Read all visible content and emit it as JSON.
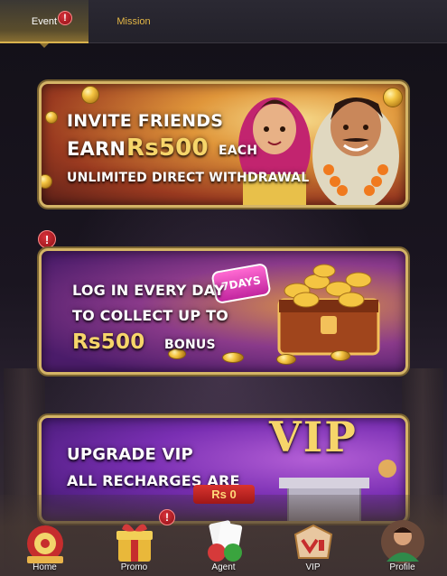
{
  "tabs": {
    "event": "Event",
    "mission": "Mission"
  },
  "alerts": {
    "glyph": "!"
  },
  "banners": [
    {
      "line1": "INVITE FRIENDS",
      "earn": "EARN",
      "amount": "Rs500",
      "each": "EACH",
      "line3": "UNLIMITED DIRECT WITHDRAWAL"
    },
    {
      "line1": "LOG IN EVERY DAY",
      "line2": "TO COLLECT UP TO",
      "amount": "Rs500",
      "bonus": "BONUS",
      "tag": "7DAYS"
    },
    {
      "line1": "UPGRADE VIP",
      "line2": "ALL RECHARGES ARE",
      "vip": "VIP"
    }
  ],
  "balance": "Rs 0",
  "nav": [
    {
      "label": "Home",
      "icon": "home-icon"
    },
    {
      "label": "Promo",
      "icon": "gift-icon"
    },
    {
      "label": "Agent",
      "icon": "agent-icon"
    },
    {
      "label": "VIP",
      "icon": "vip-icon"
    },
    {
      "label": "Profile",
      "icon": "profile-icon"
    }
  ],
  "colors": {
    "gold": "#f6d56a",
    "tab_gold": "#e3b646",
    "alert_red": "#c11d24",
    "banner_border": "#d4b466"
  }
}
